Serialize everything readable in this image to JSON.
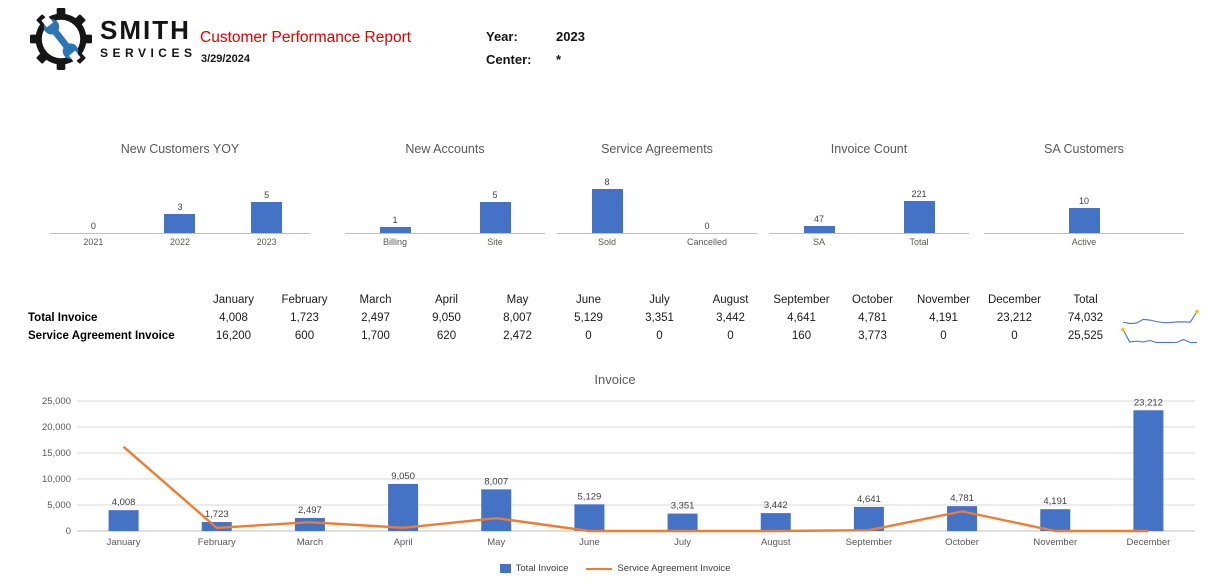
{
  "header": {
    "company_top": "SMITH",
    "company_bottom": "SERVICES",
    "title": "Customer Performance Report",
    "date": "3/29/2024",
    "year_label": "Year:",
    "year_value": "2023",
    "center_label": "Center:",
    "center_value": "*"
  },
  "colors": {
    "bar": "#4472C4",
    "line": "#ED7D31",
    "title_red": "#E00000",
    "brand_blue": "#2E75B6",
    "axis_text": "#595959",
    "gridline": "#D9D9D9",
    "sparkline": "#4472C4",
    "spark_marker": "#FFC000"
  },
  "table": {
    "columns": [
      "January",
      "February",
      "March",
      "April",
      "May",
      "June",
      "July",
      "August",
      "September",
      "October",
      "November",
      "December",
      "Total"
    ],
    "rows": [
      {
        "label": "Total Invoice",
        "values": [
          "4,008",
          "1,723",
          "2,497",
          "9,050",
          "8,007",
          "5,129",
          "3,351",
          "3,442",
          "4,641",
          "4,781",
          "4,191",
          "23,212",
          "74,032"
        ]
      },
      {
        "label": "Service Agreement Invoice",
        "values": [
          "16,200",
          "600",
          "1,700",
          "620",
          "2,472",
          "0",
          "0",
          "0",
          "160",
          "3,773",
          "0",
          "0",
          "25,525"
        ]
      }
    ]
  },
  "chart_data": [
    {
      "kind": "mini",
      "id": "new-customers-yoy",
      "type": "bar",
      "title": "New Customers YOY",
      "categories": [
        "2021",
        "2022",
        "2023"
      ],
      "values": [
        0,
        3,
        5
      ],
      "ymax": 8
    },
    {
      "kind": "mini",
      "id": "new-accounts",
      "type": "bar",
      "title": "New Accounts",
      "categories": [
        "Billing",
        "Site"
      ],
      "values": [
        1,
        5
      ],
      "ymax": 8
    },
    {
      "kind": "mini",
      "id": "service-agreements",
      "type": "bar",
      "title": "Service Agreements",
      "categories": [
        "Sold",
        "Cancelled"
      ],
      "values": [
        8,
        0
      ],
      "ymax": 9
    },
    {
      "kind": "mini",
      "id": "invoice-count",
      "type": "bar",
      "title": "Invoice Count",
      "categories": [
        "SA",
        "Total"
      ],
      "values": [
        47,
        221
      ],
      "ymax": 350
    },
    {
      "kind": "mini",
      "id": "sa-customers",
      "type": "bar",
      "title": "SA Customers",
      "categories": [
        "Active"
      ],
      "values": [
        10
      ],
      "ymax": 20
    },
    {
      "kind": "main",
      "id": "invoice",
      "type": "bar+line",
      "title": "Invoice",
      "categories": [
        "January",
        "February",
        "March",
        "April",
        "May",
        "June",
        "July",
        "August",
        "September",
        "October",
        "November",
        "December"
      ],
      "series": [
        {
          "name": "Total Invoice",
          "type": "bar",
          "color": "#4472C4",
          "values": [
            4008,
            1723,
            2497,
            9050,
            8007,
            5129,
            3351,
            3442,
            4641,
            4781,
            4191,
            23212
          ]
        },
        {
          "name": "Service Agreement Invoice",
          "type": "line",
          "color": "#ED7D31",
          "values": [
            16200,
            600,
            1700,
            620,
            2472,
            0,
            0,
            0,
            160,
            3773,
            0,
            0
          ]
        }
      ],
      "ylim": [
        0,
        25000
      ],
      "yticks": [
        0,
        5000,
        10000,
        15000,
        20000,
        25000
      ],
      "grid": true,
      "legend_position": "bottom",
      "bar_labels_visible": true
    }
  ]
}
